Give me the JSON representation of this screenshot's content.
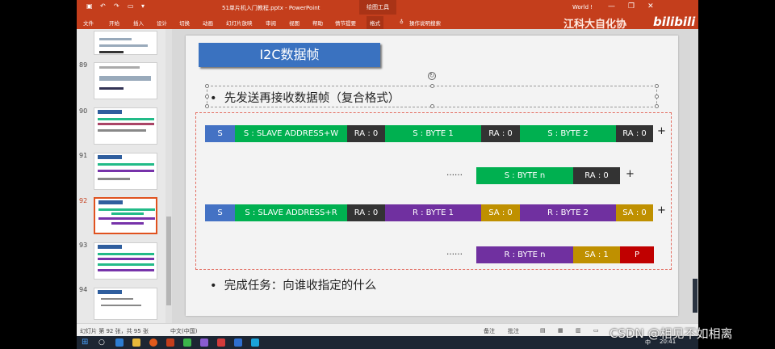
{
  "titlebar": {
    "doc_title": "51单片机入门教程.pptx - PowerPoint",
    "drawing_tools": "绘图工具",
    "user": "World !",
    "min": "—",
    "max": "❐",
    "close": "✕"
  },
  "ribbon": {
    "tabs": [
      "文件",
      "开始",
      "插入",
      "设计",
      "切换",
      "动画",
      "幻灯片放映",
      "审阅",
      "视图",
      "帮助",
      "情节提要",
      "格式"
    ],
    "tell_me": "操作说明搜索",
    "brand": "江科大自化协",
    "bilibili": "bilibili"
  },
  "slides_pane": {
    "items": [
      {
        "num": "89",
        "selected": false
      },
      {
        "num": "90",
        "selected": false
      },
      {
        "num": "91",
        "selected": false
      },
      {
        "num": "92",
        "selected": true
      },
      {
        "num": "93",
        "selected": false
      },
      {
        "num": "94",
        "selected": false
      }
    ]
  },
  "slide": {
    "title": "I2C数据帧",
    "bullet1": "先发送再接收数据帧（复合格式）",
    "bullet2": "完成任务：向谁收指定的什么",
    "row1": [
      "S",
      "S : SLAVE ADDRESS+W",
      "RA : 0",
      "S : BYTE 1",
      "RA : 0",
      "S : BYTE 2",
      "RA : 0"
    ],
    "row2": [
      "S : BYTE n",
      "RA : 0"
    ],
    "row3": [
      "S",
      "S : SLAVE ADDRESS+R",
      "RA : 0",
      "R : BYTE 1",
      "SA : 0",
      "R : BYTE 2",
      "SA : 0"
    ],
    "row4": [
      "R : BYTE n",
      "SA : 1",
      "P"
    ],
    "plus": "+",
    "ellipsis": "……"
  },
  "colors": {
    "blue": "#4472c4",
    "green": "#00b050",
    "dark": "#333333",
    "purple": "#7030a0",
    "gold": "#bf9000",
    "red": "#c00000",
    "ppt_red": "#c43e1c"
  },
  "status": {
    "slide_info": "幻灯片 第 92 张，共 95 张",
    "language": "中文(中国)",
    "notes": "备注",
    "comments": "批注"
  },
  "taskbar": {
    "time": "20:41",
    "ime": "中"
  },
  "watermark": "CSDN @相见不如相离"
}
